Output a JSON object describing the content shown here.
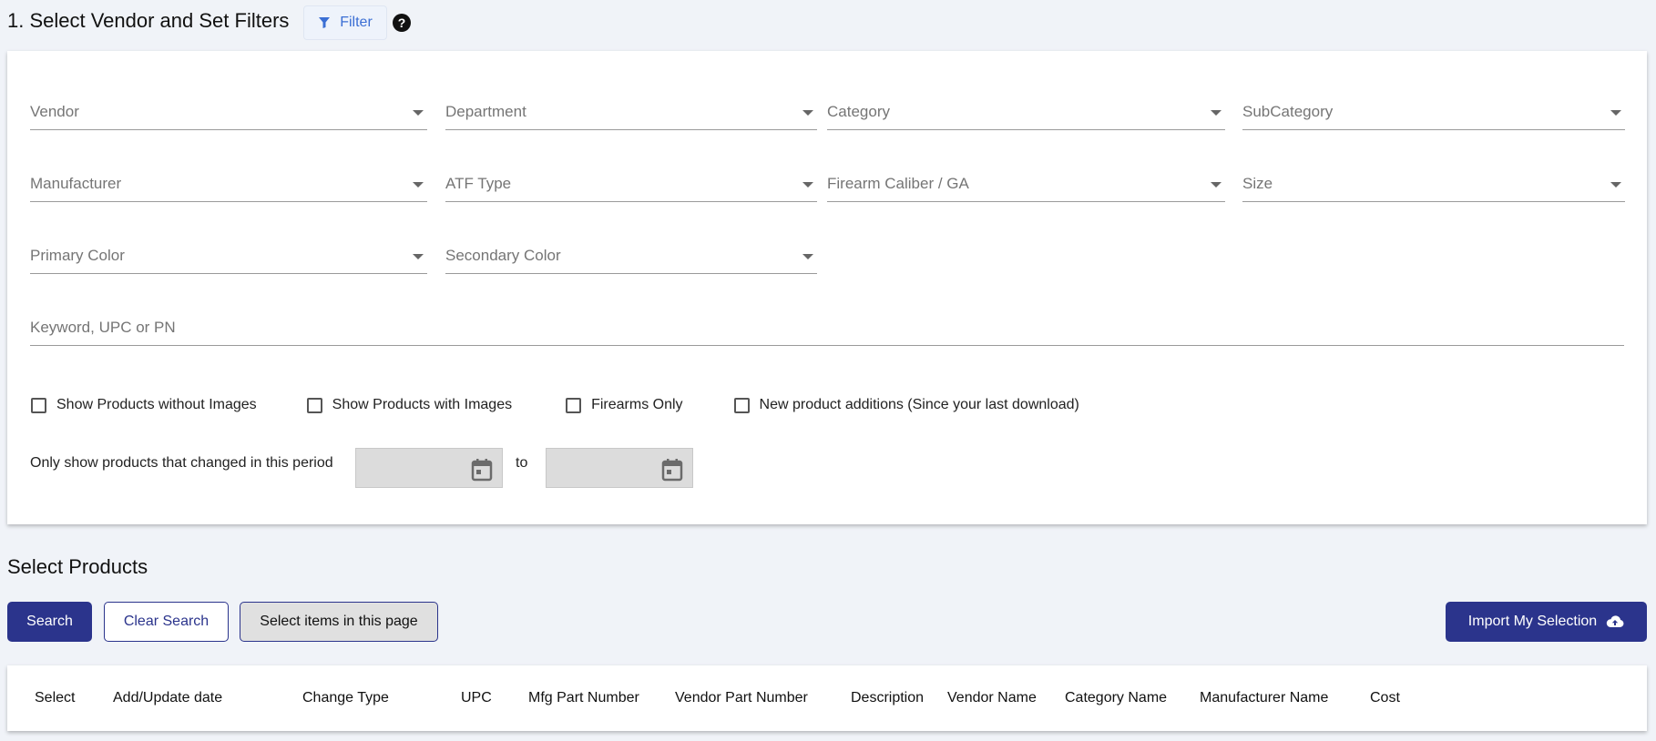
{
  "header": {
    "title": "1. Select Vendor and Set Filters",
    "filter_label": "Filter",
    "help_glyph": "?"
  },
  "filters": {
    "vendor": "Vendor",
    "department": "Department",
    "category": "Category",
    "subcategory": "SubCategory",
    "manufacturer": "Manufacturer",
    "atf_type": "ATF Type",
    "caliber": "Firearm Caliber / GA",
    "size": "Size",
    "primary_color": "Primary Color",
    "secondary_color": "Secondary Color",
    "keyword": "Keyword, UPC or PN"
  },
  "checkboxes": {
    "without_images": "Show Products without Images",
    "with_images": "Show Products with Images",
    "firearms_only": "Firearms Only",
    "new_additions": "New product additions (Since your last download)"
  },
  "period": {
    "label": "Only show products that changed in this period",
    "to": "to",
    "from_value": "",
    "to_value": ""
  },
  "products": {
    "title": "Select Products",
    "search": "Search",
    "clear": "Clear Search",
    "select_page": "Select items in this page",
    "import": "Import My Selection"
  },
  "table": {
    "columns": [
      "Select",
      "Add/Update date",
      "Change Type",
      "UPC",
      "Mfg Part Number",
      "Vendor Part Number",
      "Description",
      "Vendor Name",
      "Category Name",
      "Manufacturer Name",
      "Cost"
    ]
  },
  "colors": {
    "primary": "#2b348c",
    "filter_accent": "#3b6fd4",
    "background": "#f0f3f8"
  }
}
